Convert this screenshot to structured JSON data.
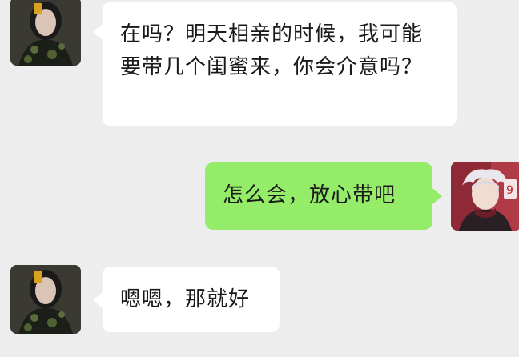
{
  "chat": {
    "messages": [
      {
        "direction": "incoming",
        "text": "在吗？明天相亲的时候，我可能要带几个闺蜜来，你会介意吗？",
        "avatar": "contact-avatar"
      },
      {
        "direction": "outgoing",
        "text": "怎么会，放心带吧",
        "avatar": "self-avatar"
      },
      {
        "direction": "incoming",
        "text": "嗯嗯，那就好",
        "avatar": "contact-avatar"
      }
    ]
  },
  "colors": {
    "background": "#ededed",
    "incoming_bubble": "#ffffff",
    "outgoing_bubble": "#95ec69",
    "text": "#1a1a1a"
  }
}
